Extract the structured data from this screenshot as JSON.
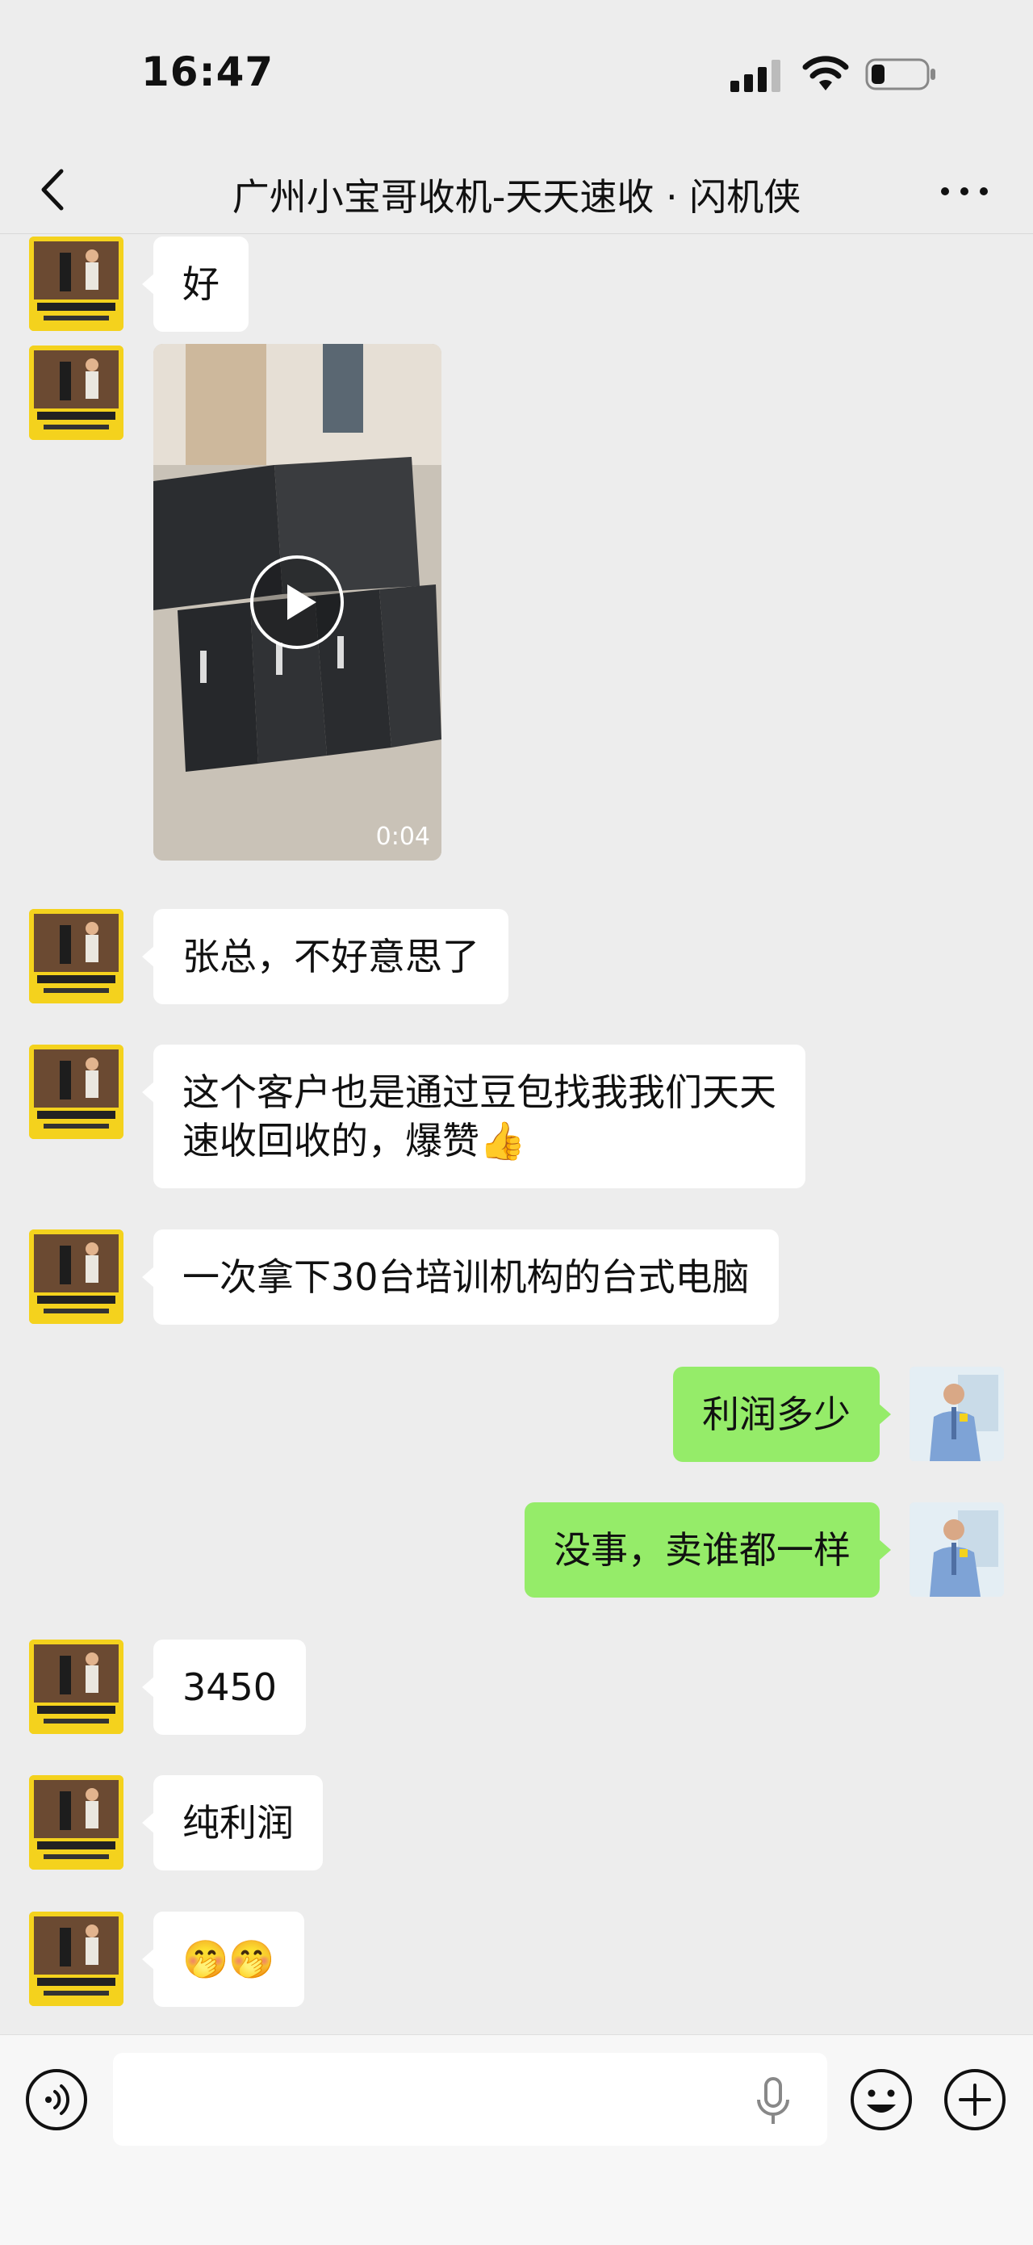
{
  "status_bar": {
    "time": "16:47"
  },
  "nav": {
    "title": "广州小宝哥收机-天天速收 · 闪机侠"
  },
  "messages": [
    {
      "side": "left",
      "type": "text",
      "text": "好"
    },
    {
      "side": "left",
      "type": "video",
      "duration": "0:04"
    },
    {
      "side": "left",
      "type": "text",
      "text": "张总，不好意思了"
    },
    {
      "side": "left",
      "type": "text",
      "line1": "这个客户也是通过豆包找我我们天天",
      "line2": "速收回收的，爆赞👍"
    },
    {
      "side": "left",
      "type": "text",
      "text": "一次拿下30台培训机构的台式电脑"
    },
    {
      "side": "right",
      "type": "text",
      "text": "利润多少"
    },
    {
      "side": "right",
      "type": "text",
      "text": "没事，卖谁都一样"
    },
    {
      "side": "left",
      "type": "text",
      "text": "3450"
    },
    {
      "side": "left",
      "type": "text",
      "text": "纯利润"
    },
    {
      "side": "left",
      "type": "text",
      "text": "🤭🤭"
    }
  ],
  "input": {
    "value": ""
  }
}
